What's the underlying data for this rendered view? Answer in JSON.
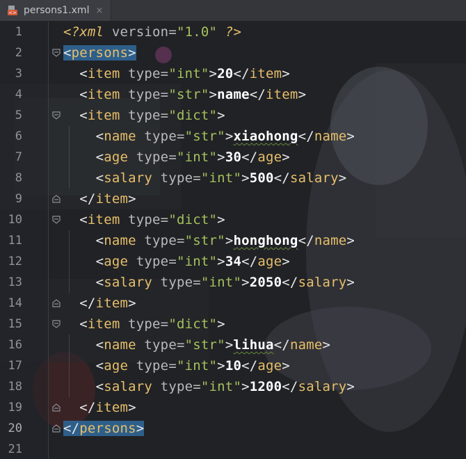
{
  "tab": {
    "title": "persons1.xml",
    "icon": "xml-file-icon",
    "close_glyph": "×"
  },
  "editor": {
    "lines": [
      {
        "n": "1",
        "indent": 0,
        "kind": "decl"
      },
      {
        "n": "2",
        "indent": 0,
        "kind": "open-root"
      },
      {
        "n": "3",
        "indent": 1,
        "kind": "leaf",
        "tag": "item",
        "type": "int",
        "text": "20"
      },
      {
        "n": "4",
        "indent": 1,
        "kind": "leaf",
        "tag": "item",
        "type": "str",
        "text": "name"
      },
      {
        "n": "5",
        "indent": 1,
        "kind": "open",
        "tag": "item",
        "type": "dict"
      },
      {
        "n": "6",
        "indent": 2,
        "kind": "leaf",
        "tag": "name",
        "type": "str",
        "text": "xiaohong"
      },
      {
        "n": "7",
        "indent": 2,
        "kind": "leaf",
        "tag": "age",
        "type": "int",
        "text": "30"
      },
      {
        "n": "8",
        "indent": 2,
        "kind": "leaf",
        "tag": "salary",
        "type": "int",
        "text": "500"
      },
      {
        "n": "9",
        "indent": 1,
        "kind": "close",
        "tag": "item"
      },
      {
        "n": "10",
        "indent": 1,
        "kind": "open",
        "tag": "item",
        "type": "dict"
      },
      {
        "n": "11",
        "indent": 2,
        "kind": "leaf",
        "tag": "name",
        "type": "str",
        "text": "honghong"
      },
      {
        "n": "12",
        "indent": 2,
        "kind": "leaf",
        "tag": "age",
        "type": "int",
        "text": "34"
      },
      {
        "n": "13",
        "indent": 2,
        "kind": "leaf",
        "tag": "salary",
        "type": "int",
        "text": "2050"
      },
      {
        "n": "14",
        "indent": 1,
        "kind": "close",
        "tag": "item"
      },
      {
        "n": "15",
        "indent": 1,
        "kind": "open",
        "tag": "item",
        "type": "dict"
      },
      {
        "n": "16",
        "indent": 2,
        "kind": "leaf",
        "tag": "name",
        "type": "str",
        "text": "lihua"
      },
      {
        "n": "17",
        "indent": 2,
        "kind": "leaf",
        "tag": "age",
        "type": "int",
        "text": "10"
      },
      {
        "n": "18",
        "indent": 2,
        "kind": "leaf",
        "tag": "salary",
        "type": "int",
        "text": "1200"
      },
      {
        "n": "19",
        "indent": 1,
        "kind": "close",
        "tag": "item"
      },
      {
        "n": "20",
        "indent": 0,
        "kind": "close-root"
      },
      {
        "n": "21",
        "indent": 0,
        "kind": "empty"
      }
    ],
    "decl": {
      "open": "<?",
      "name": "xml",
      "attr": "version",
      "value": "\"1.0\"",
      "close": "?>"
    },
    "root_tag": "persons",
    "attr_name": "type",
    "squiggled_words": [
      "xiaohong",
      "honghong",
      "lihua"
    ]
  },
  "colors": {
    "tag": "#e8bf6a",
    "attr": "#bababa",
    "value": "#a5c25c",
    "text": "#ffffff",
    "match_highlight": "#2e5f8a"
  }
}
